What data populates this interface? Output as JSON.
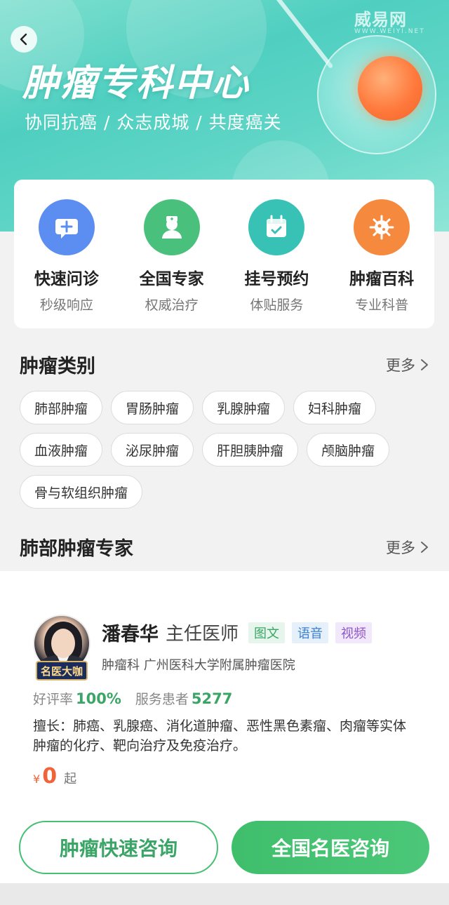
{
  "header": {
    "back_icon": "chevron-left-icon",
    "watermark": "威易网",
    "watermark_sub": "WWW.WEIYI.NET",
    "title": "肿瘤专科中心",
    "subtitle": "协同抗癌 / 众志成城 / 共度癌关"
  },
  "services": [
    {
      "title": "快速问诊",
      "subtitle": "秒级响应",
      "icon": "chat-plus-icon",
      "color": "#5b8ef0"
    },
    {
      "title": "全国专家",
      "subtitle": "权威治疗",
      "icon": "doctor-icon",
      "color": "#49c07c"
    },
    {
      "title": "挂号预约",
      "subtitle": "体贴服务",
      "icon": "calendar-icon",
      "color": "#38c2b5"
    },
    {
      "title": "肿瘤百科",
      "subtitle": "专业科普",
      "icon": "virus-icon",
      "color": "#f58a3f"
    }
  ],
  "categories": {
    "title": "肿瘤类别",
    "more": "更多",
    "tags": [
      "肺部肿瘤",
      "胃肠肿瘤",
      "乳腺肿瘤",
      "妇科肿瘤",
      "血液肿瘤",
      "泌尿肿瘤",
      "肝胆胰肿瘤",
      "颅脑肿瘤",
      "骨与软组织肿瘤"
    ]
  },
  "experts": {
    "title": "肺部肿瘤专家",
    "more": "更多"
  },
  "doctor": {
    "badge": "名医大咖",
    "name": "潘春华",
    "title": "主任医师",
    "modes": [
      "图文",
      "语音",
      "视频"
    ],
    "department": "肿瘤科 广州医科大学附属肿瘤医院",
    "rating_label": "好评率",
    "rating_value": "100%",
    "patients_label": "服务患者",
    "patients_value": "5277",
    "expertise": "擅长：肺癌、乳腺癌、消化道肿瘤、恶性黑色素瘤、肉瘤等实体肿瘤的化疗、靶向治疗及免疫治疗。",
    "price_currency": "¥",
    "price_amount": "0",
    "price_suffix": "起"
  },
  "actions": {
    "quick_consult": "肿瘤快速咨询",
    "national_consult": "全国名医咨询"
  },
  "colors": {
    "accent_green": "#3aa566",
    "price_orange": "#f0643a"
  }
}
